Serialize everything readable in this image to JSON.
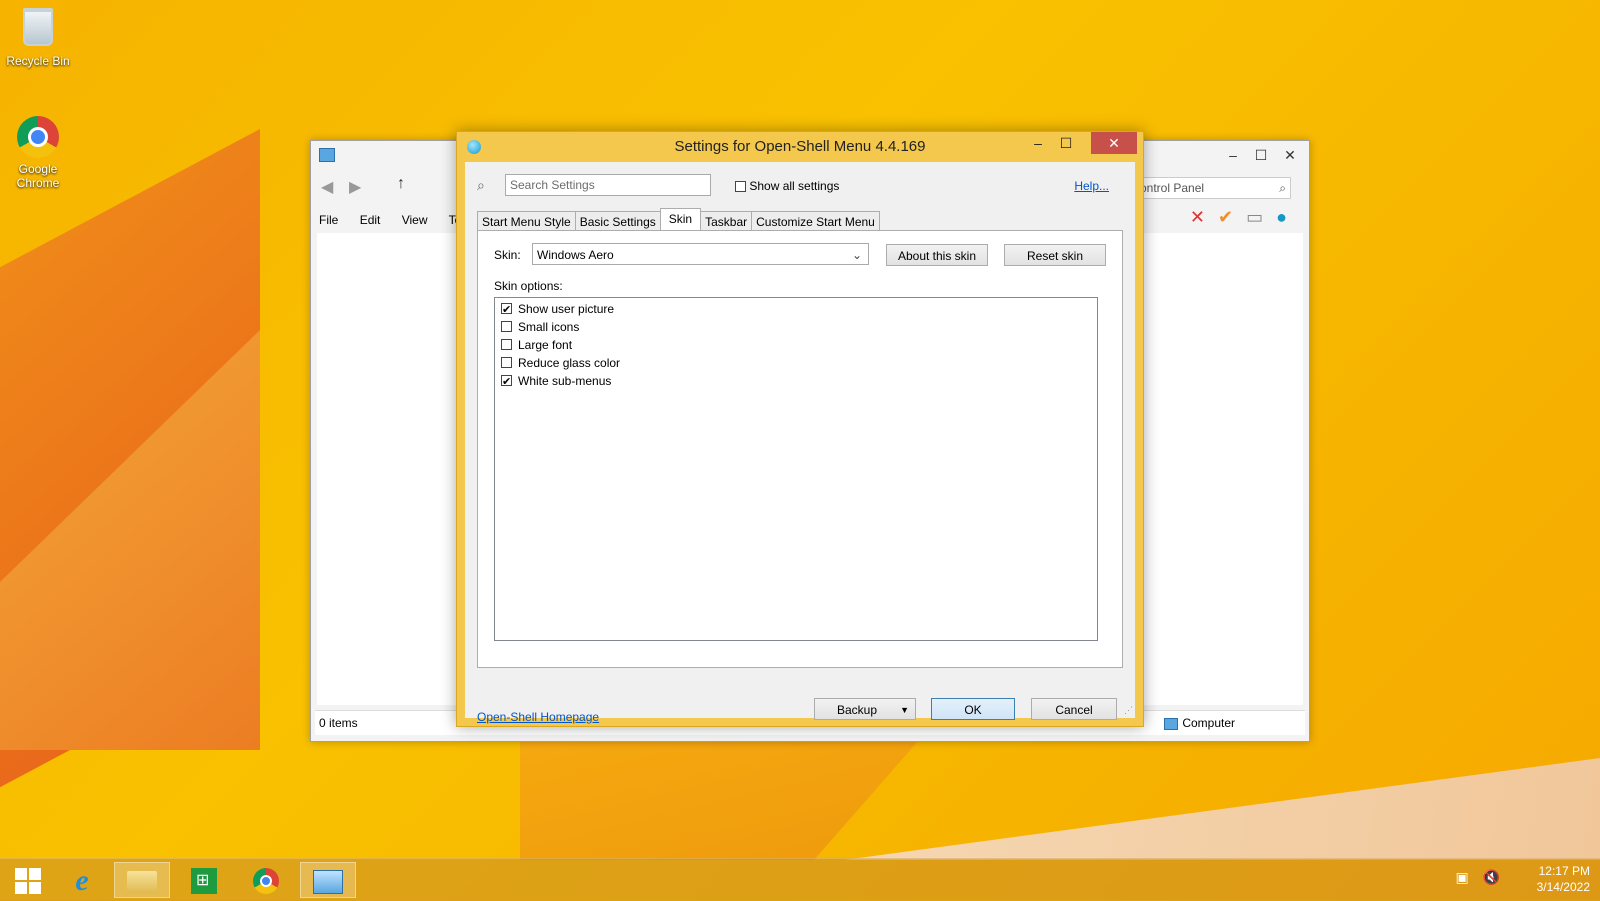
{
  "desktop": {
    "icons": [
      {
        "label": "Recycle Bin",
        "icon": "recycle-bin-icon"
      },
      {
        "label": "Google Chrome",
        "icon": "chrome-icon"
      }
    ]
  },
  "explorer": {
    "menu": [
      "File",
      "Edit",
      "View",
      "Too"
    ],
    "address_text": "ontrol Panel",
    "status_items": "0 items",
    "status_location": "Computer"
  },
  "dialog": {
    "title": "Settings for Open-Shell Menu 4.4.169",
    "search_placeholder": "Search Settings",
    "show_all_label": "Show all settings",
    "show_all_checked": false,
    "help_label": "Help...",
    "tabs": [
      "Start Menu Style",
      "Basic Settings",
      "Skin",
      "Taskbar",
      "Customize Start Menu"
    ],
    "active_tab": "Skin",
    "skin_label": "Skin:",
    "skin_value": "Windows Aero",
    "about_skin_label": "About this skin",
    "reset_skin_label": "Reset skin",
    "skin_options_label": "Skin options:",
    "options": [
      {
        "label": "Show user picture",
        "checked": true
      },
      {
        "label": "Small icons",
        "checked": false
      },
      {
        "label": "Large font",
        "checked": false
      },
      {
        "label": "Reduce glass color",
        "checked": false
      },
      {
        "label": "White sub-menus",
        "checked": true
      }
    ],
    "homepage_label": "Open-Shell Homepage",
    "backup_label": "Backup",
    "ok_label": "OK",
    "cancel_label": "Cancel"
  },
  "taskbar": {
    "items": [
      "start-icon",
      "internet-explorer-icon",
      "file-explorer-icon",
      "store-icon",
      "chrome-icon",
      "control-panel-icon"
    ],
    "time": "12:17 PM",
    "date": "3/14/2022"
  }
}
